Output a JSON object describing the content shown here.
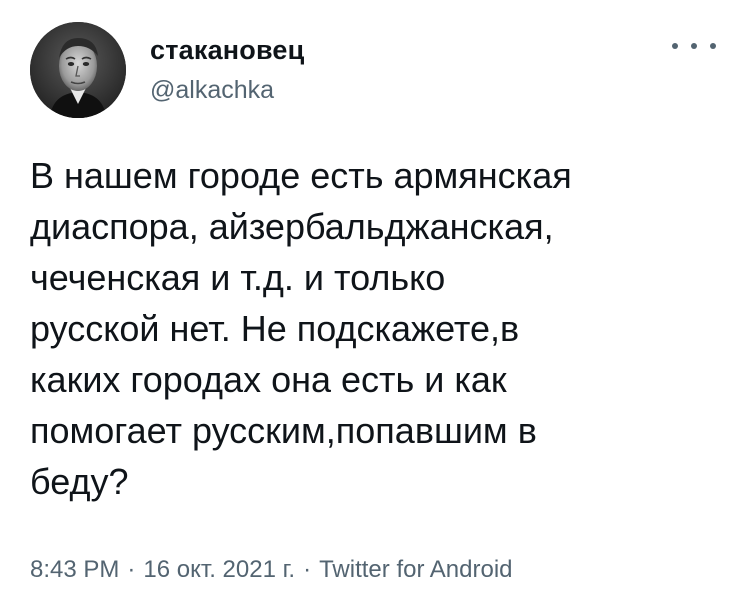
{
  "tweet": {
    "author": {
      "display_name": "стакановец",
      "handle": "@alkachka",
      "avatar_icon": "profile-photo"
    },
    "more_icon": "more-horizontal-icon",
    "text_lines": [
      "В нашем городе есть армянская",
      "диаспора, айзербальджанская,",
      "чеченская и т.д. и только",
      "русской нет. Не подскажете,в",
      "каких городах она есть и как",
      "помогает русским,попавшим в",
      "беду?"
    ],
    "meta": {
      "time": "8:43 PM",
      "separator": "·",
      "date": "16 окт. 2021 г.",
      "source": "Twitter for Android"
    }
  },
  "colors": {
    "text_primary": "#0f1419",
    "text_secondary": "#536471",
    "background": "#ffffff"
  }
}
